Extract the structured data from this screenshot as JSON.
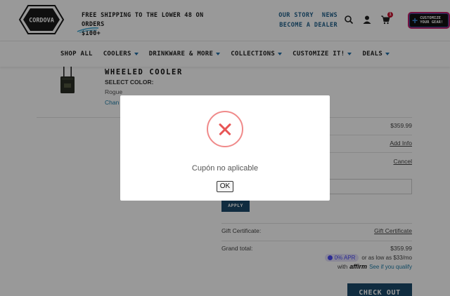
{
  "header": {
    "logo_text": "CORDOVA",
    "shipping_line1": "FREE SHIPPING TO THE LOWER 48 ON ORDERS",
    "shipping_line2": "$100+",
    "links": {
      "our_story": "OUR STORY",
      "news": "NEWS",
      "become_dealer": "BECOME A DEALER"
    },
    "cart_count": "1",
    "customize_line1": "CUSTOMIZE",
    "customize_line2": "YOUR GEAR!",
    "icons": [
      "search-icon",
      "account-icon",
      "cart-icon"
    ]
  },
  "nav": {
    "items": [
      {
        "label": "SHOP ALL",
        "dropdown": false
      },
      {
        "label": "COOLERS",
        "dropdown": true
      },
      {
        "label": "DRINKWARE & MORE",
        "dropdown": true
      },
      {
        "label": "COLLECTIONS",
        "dropdown": true
      },
      {
        "label": "CUSTOMIZE IT!",
        "dropdown": true
      },
      {
        "label": "DEALS",
        "dropdown": true
      }
    ]
  },
  "cart_item": {
    "name": "WHEELED COOLER",
    "select_color_label": "SELECT COLOR:",
    "color_value": "Rogue",
    "change_link": "Chan"
  },
  "summary": {
    "price": "$359.99",
    "add_info": "Add Info",
    "cancel": "Cancel",
    "coupon_placeholder": "",
    "apply": "APPLY",
    "gift_cert_label": "Gift Certificate:",
    "gift_cert_link": "Gift Certificate",
    "grand_total_label": "Grand total:",
    "grand_total_value": "$359.99",
    "affirm_apr": "0% APR",
    "affirm_text": "or as low as $33/mo",
    "affirm_with": "with",
    "affirm_logo": "affirm",
    "affirm_link": "See if you qualify",
    "checkout": "CHECK OUT"
  },
  "modal": {
    "message": "Cupón no aplicable",
    "ok_label": "OK",
    "icon": "error-x-icon"
  },
  "colors": {
    "brand_blue": "#1b4a6b",
    "link_blue": "#1e7da8",
    "nav_caret": "#1e6fa8",
    "error_red": "#e85757",
    "badge_red": "#c8102e"
  }
}
